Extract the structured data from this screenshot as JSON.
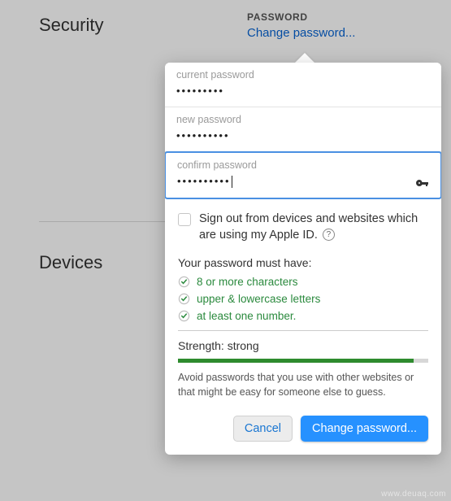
{
  "sections": {
    "security": "Security",
    "devices": "Devices"
  },
  "passwordHeader": {
    "caption": "PASSWORD",
    "link": "Change password..."
  },
  "fields": {
    "current": {
      "label": "current password",
      "value": "•••••••••"
    },
    "new": {
      "label": "new password",
      "value": "••••••••••"
    },
    "confirm": {
      "label": "confirm password",
      "value": "••••••••••"
    }
  },
  "signout": {
    "label": "Sign out from devices and websites which are using my Apple ID."
  },
  "requirements": {
    "title": "Your password must have:",
    "items": [
      "8 or more characters",
      "upper & lowercase letters",
      "at least one number."
    ]
  },
  "strength": {
    "label": "Strength: strong"
  },
  "advice": "Avoid passwords that you use with other websites or that might be easy for someone else to guess.",
  "buttons": {
    "cancel": "Cancel",
    "submit": "Change password..."
  },
  "watermark": "www.deuaq.com"
}
